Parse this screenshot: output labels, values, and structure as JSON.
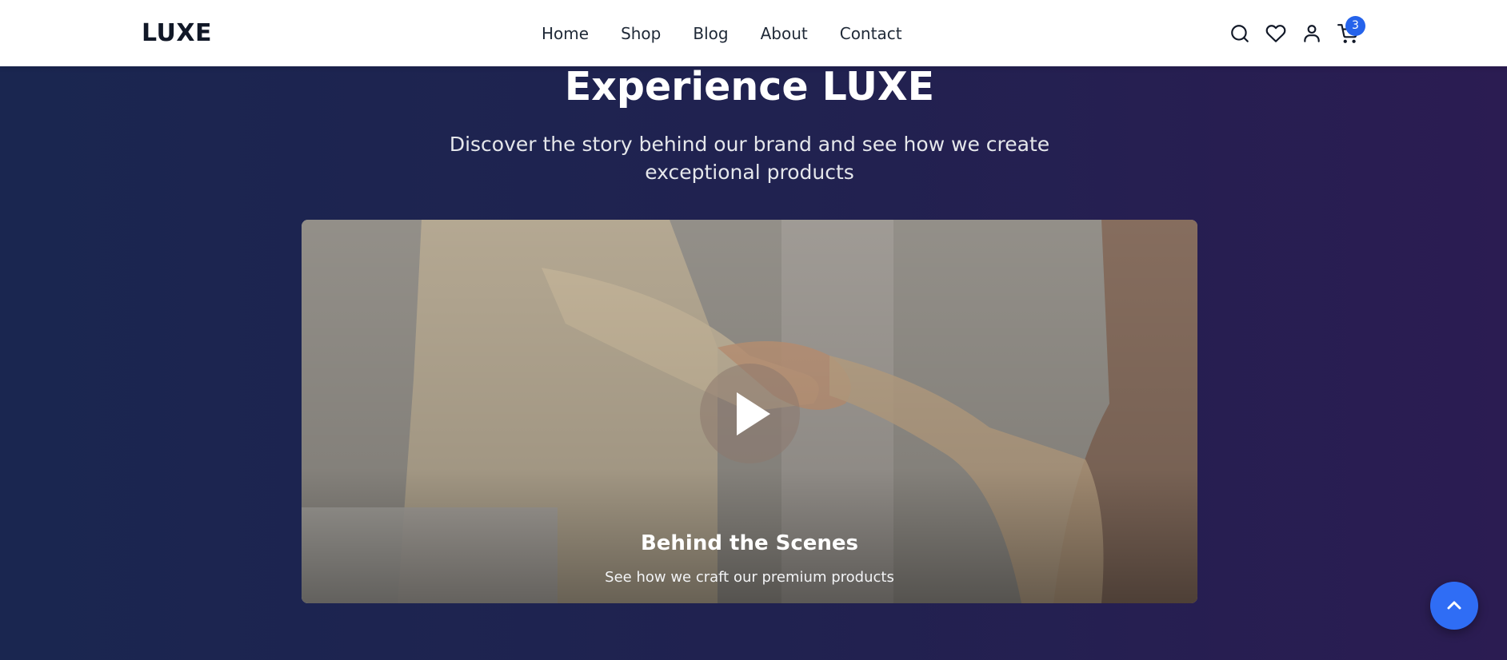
{
  "header": {
    "logo": "LUXE",
    "nav": [
      {
        "label": "Home"
      },
      {
        "label": "Shop"
      },
      {
        "label": "Blog"
      },
      {
        "label": "About"
      },
      {
        "label": "Contact"
      }
    ],
    "icons": [
      "search-icon",
      "heart-icon",
      "user-icon",
      "cart-icon"
    ],
    "cart_count": "3"
  },
  "hero": {
    "title": "Experience LUXE",
    "subtitle": "Discover the story behind our brand and see how we create exceptional products"
  },
  "video": {
    "title": "Behind the Scenes",
    "subtitle": "See how we craft our premium products",
    "play_icon": "play-icon"
  },
  "scroll_top_icon": "chevron-up-icon",
  "colors": {
    "accent": "#2563eb",
    "background_start": "#1a2650",
    "background_end": "#2b1c52"
  }
}
